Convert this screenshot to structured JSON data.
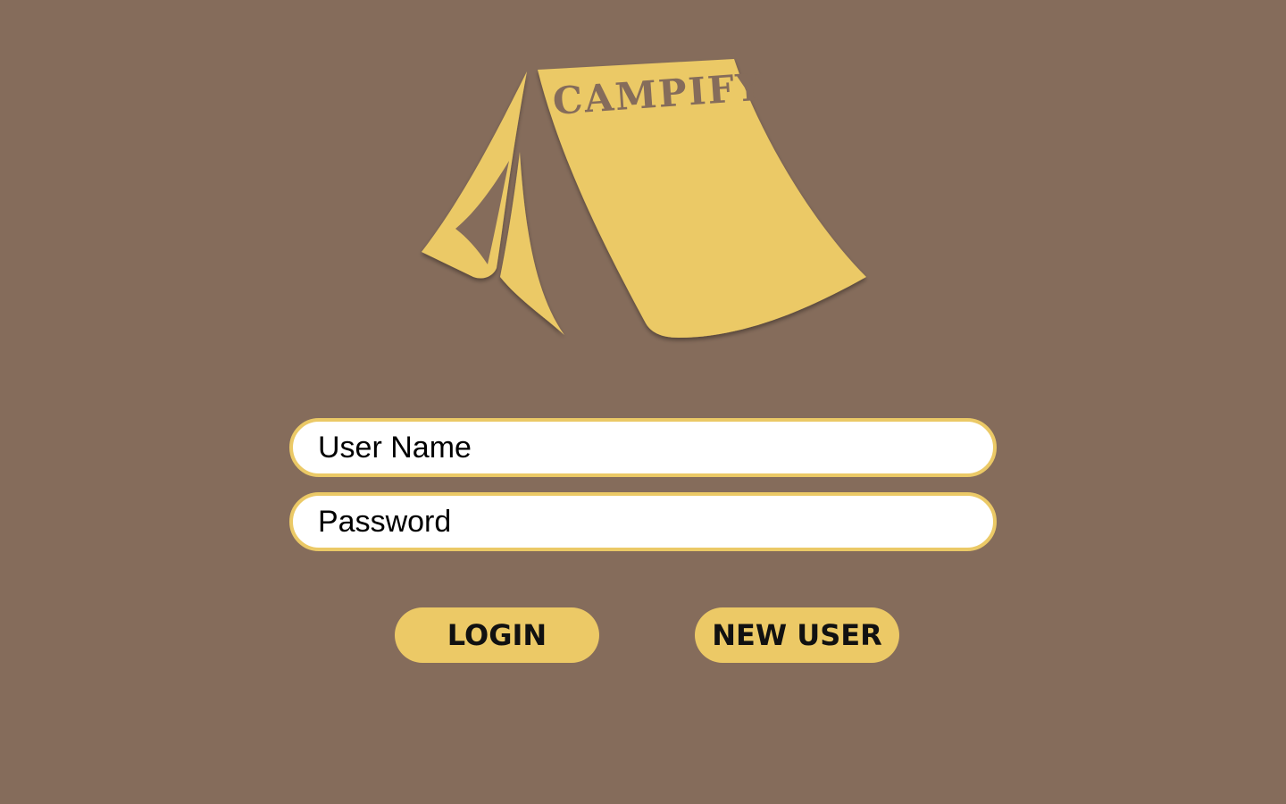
{
  "logo": {
    "text": "CAMPIFY",
    "icon": "tent-icon",
    "color": "#ebc966",
    "text_color": "#856c5b"
  },
  "form": {
    "username_placeholder": "User Name",
    "password_placeholder": "Password"
  },
  "buttons": {
    "login_label": "LOGIN",
    "new_user_label": "NEW USER"
  },
  "colors": {
    "background": "#856c5b",
    "accent": "#ebc966",
    "field_bg": "#ffffff"
  }
}
